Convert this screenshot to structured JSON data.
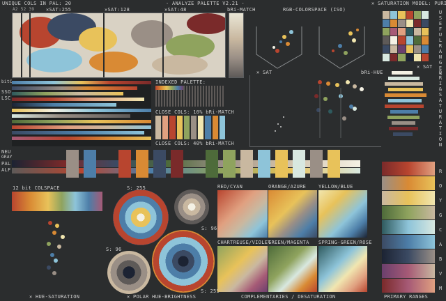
{
  "header": {
    "unique_cols": "UNIQUE COLS IN PAL: 20",
    "title": "- ANALYZE PALETTE V2.21 -",
    "saturation_model": "✕ SATURATION MODEL: PURIST"
  },
  "sat_labels": {
    "sat_small": "A2 52 39",
    "sat255": "✕SAT:255",
    "sat128": "✕SAT:128",
    "sat48": "✕SAT:48",
    "bri_match": "bRi-MATCH",
    "rgb_space": "RGB-COLORSPACE (ISO)"
  },
  "side_labels": {
    "useful_ranges": "USEFUL RANGES",
    "bri_saturation": "BRI & SATURATION",
    "hue_letters": "R O Y G C A B V M"
  },
  "left_labels": {
    "bitc": "bitC",
    "ssb": "SSO",
    "lsc": "LSC",
    "new": "NEU",
    "gray": "GRAY",
    "pal": "PAL",
    "alf": "ALF"
  },
  "panels": {
    "indexed_palette": "INDEXED PALETTE:",
    "close_cols_10": "CLOSE COLS: 10% bRi-MATCH",
    "close_cols_40": "CLOSE COLS: 40% bRi-MATCH",
    "x_sat": "✕ SAT",
    "bri_hue": "bRi-HUE",
    "x_sat_right": "✕ SAT",
    "colspace_12bit": "12 bit COLSPACE",
    "s255_a": "S: 255",
    "s96_a": "S: 96",
    "s96_b": "S: 96",
    "s255_b": "S: 255"
  },
  "complement_panels": [
    {
      "label": "RED/CYAN"
    },
    {
      "label": "ORANGE/AZURE"
    },
    {
      "label": "YELLOW/BLUE"
    },
    {
      "label": "CHARTREUSE/VIOLET"
    },
    {
      "label": "GREEN/MAGENTA"
    },
    {
      "label": "SPRING-GREEN/ROSE"
    }
  ],
  "footer": {
    "hue_saturation": "✕ HUE-SATURATION",
    "polar": "✕ POLAR HUE-BRIGHTNESS",
    "complementaries": "COMPLEMENTARIES / DESATURATION",
    "primary_ranges": "PRIMARY RANGES"
  },
  "palette": [
    "#1c2333",
    "#3b4a63",
    "#4d7ea8",
    "#8ec4d9",
    "#d8e8e0",
    "#f1e6b0",
    "#e8c25a",
    "#d98a34",
    "#b8452f",
    "#7a2a2a",
    "#4e6b3a",
    "#8fa35e",
    "#c9b8a0",
    "#9a8f86",
    "#5e5a58",
    "#a65a76",
    "#6b3f6d",
    "#e0a080",
    "#2f5a5e",
    "#f4f1e4"
  ],
  "colors": {
    "background": "#2b2d2e",
    "frame": "#5a5d5f",
    "text": "#cfcfcf"
  }
}
